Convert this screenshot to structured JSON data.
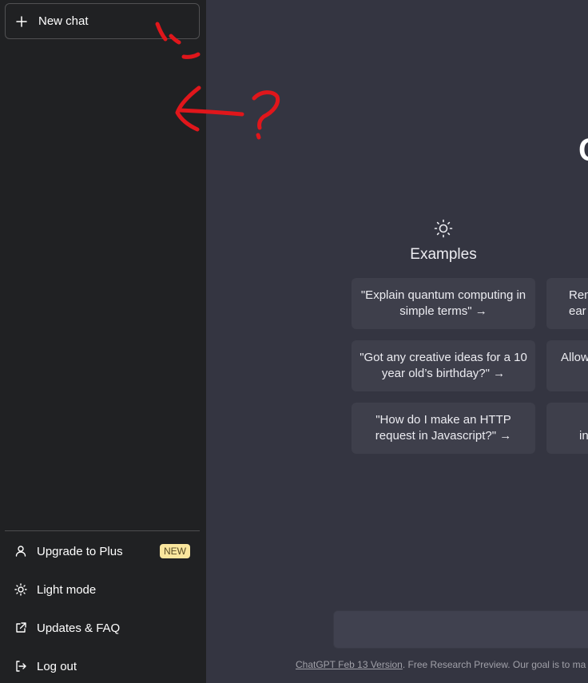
{
  "sidebar": {
    "new_chat_label": "New chat",
    "items": [
      {
        "label": "Upgrade to Plus",
        "icon": "user-icon",
        "badge": "NEW"
      },
      {
        "label": "Light mode",
        "icon": "sun-icon"
      },
      {
        "label": "Updates & FAQ",
        "icon": "external-link-icon"
      },
      {
        "label": "Log out",
        "icon": "logout-icon"
      }
    ]
  },
  "main": {
    "logo_fragment": "C",
    "examples": {
      "title": "Examples",
      "icon": "sun-icon",
      "cards": [
        "\"Explain quantum computing in simple terms\" →",
        "\"Got any creative ideas for a 10 year old’s birthday?\" →",
        "\"How do I make an HTTP request in Javascript?\" →"
      ]
    },
    "second_column_fragments": [
      "Rem\near",
      "Allow",
      "\nin"
    ]
  },
  "footer": {
    "version_link": "ChatGPT Feb 13 Version",
    "text": ". Free Research Preview. Our goal is to ma"
  },
  "colors": {
    "sidebar_bg": "#202123",
    "main_bg": "#343541",
    "card_bg": "#3e3f4b",
    "badge_bg": "#fae69e",
    "annotation_red": "#e0161b"
  }
}
